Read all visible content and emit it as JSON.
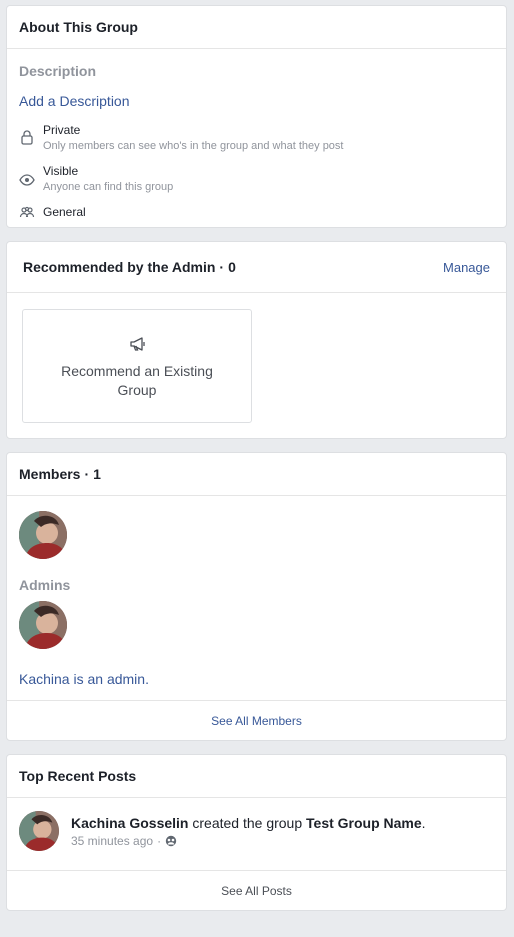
{
  "about": {
    "title": "About This Group",
    "description_label": "Description",
    "add_description": "Add a Description",
    "privacy_title": "Private",
    "privacy_sub": "Only members can see who's in the group and what they post",
    "visibility_title": "Visible",
    "visibility_sub": "Anyone can find this group",
    "category": "General"
  },
  "recommended": {
    "title": "Recommended by the Admin",
    "count": "0",
    "manage_label": "Manage",
    "recommend_label": "Recommend an Existing Group"
  },
  "members": {
    "title": "Members",
    "count": "1",
    "admins_label": "Admins",
    "admin_note": "Kachina is an admin.",
    "see_all": "See All Members"
  },
  "posts": {
    "title": "Top Recent Posts",
    "author": "Kachina Gosselin",
    "action": "created the group",
    "group_name": "Test Group Name",
    "period": ".",
    "time": "35 minutes ago",
    "see_all": "See All Posts"
  },
  "colors": {
    "link": "#385898",
    "muted": "#90949c",
    "background": "#e9ebee"
  }
}
